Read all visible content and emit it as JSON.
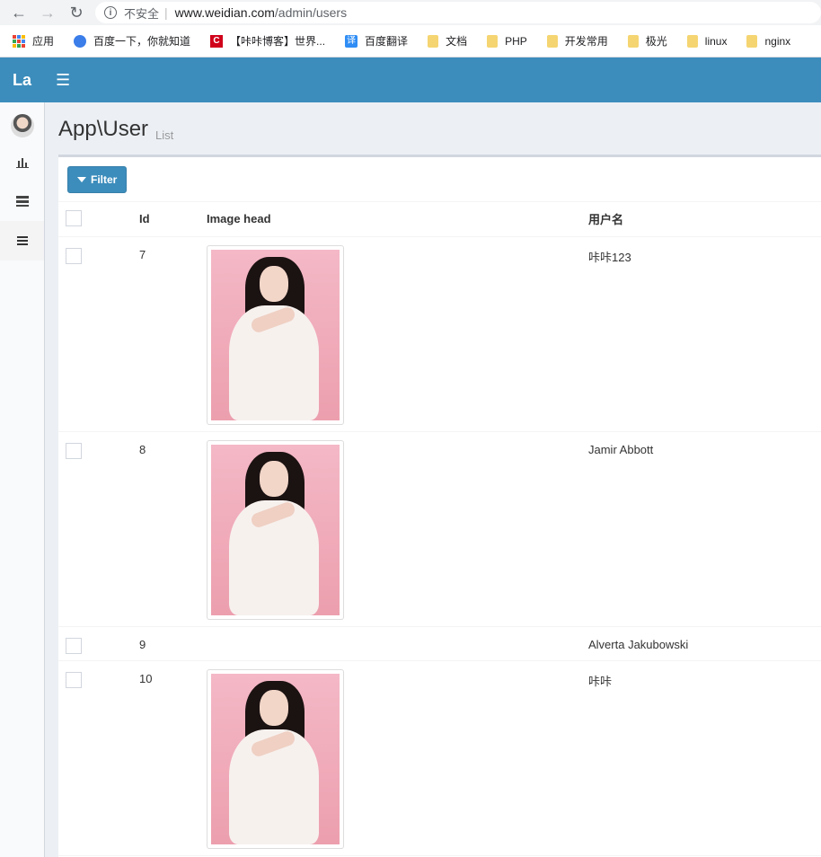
{
  "browser": {
    "insecure_label": "不安全",
    "url_host": "www.weidian.com",
    "url_path": "/admin/users",
    "bookmarks": [
      {
        "label": "应用",
        "icon": "apps-icon"
      },
      {
        "label": "百度一下，你就知道",
        "icon": "baidu-icon"
      },
      {
        "label": "【咔咔博客】世界...",
        "icon": "c-icon"
      },
      {
        "label": "百度翻译",
        "icon": "translate-icon"
      },
      {
        "label": "文档",
        "icon": "folder-icon"
      },
      {
        "label": "PHP",
        "icon": "folder-icon"
      },
      {
        "label": "开发常用",
        "icon": "folder-icon"
      },
      {
        "label": "极光",
        "icon": "folder-icon"
      },
      {
        "label": "linux",
        "icon": "folder-icon"
      },
      {
        "label": "nginx",
        "icon": "folder-icon"
      }
    ]
  },
  "header": {
    "logo": "La"
  },
  "page": {
    "title": "App\\User",
    "subtitle": "List"
  },
  "toolbar": {
    "filter_label": "Filter"
  },
  "table": {
    "columns": [
      "Id",
      "Image head",
      "用户名"
    ],
    "rows": [
      {
        "id": "7",
        "has_image": true,
        "username": "咔咔123"
      },
      {
        "id": "8",
        "has_image": true,
        "username": "Jamir Abbott"
      },
      {
        "id": "9",
        "has_image": false,
        "username": "Alverta Jakubowski"
      },
      {
        "id": "10",
        "has_image": true,
        "username": "咔咔"
      }
    ]
  },
  "colors": {
    "header_bg": "#3c8dbc",
    "content_bg": "#ecf0f5"
  }
}
